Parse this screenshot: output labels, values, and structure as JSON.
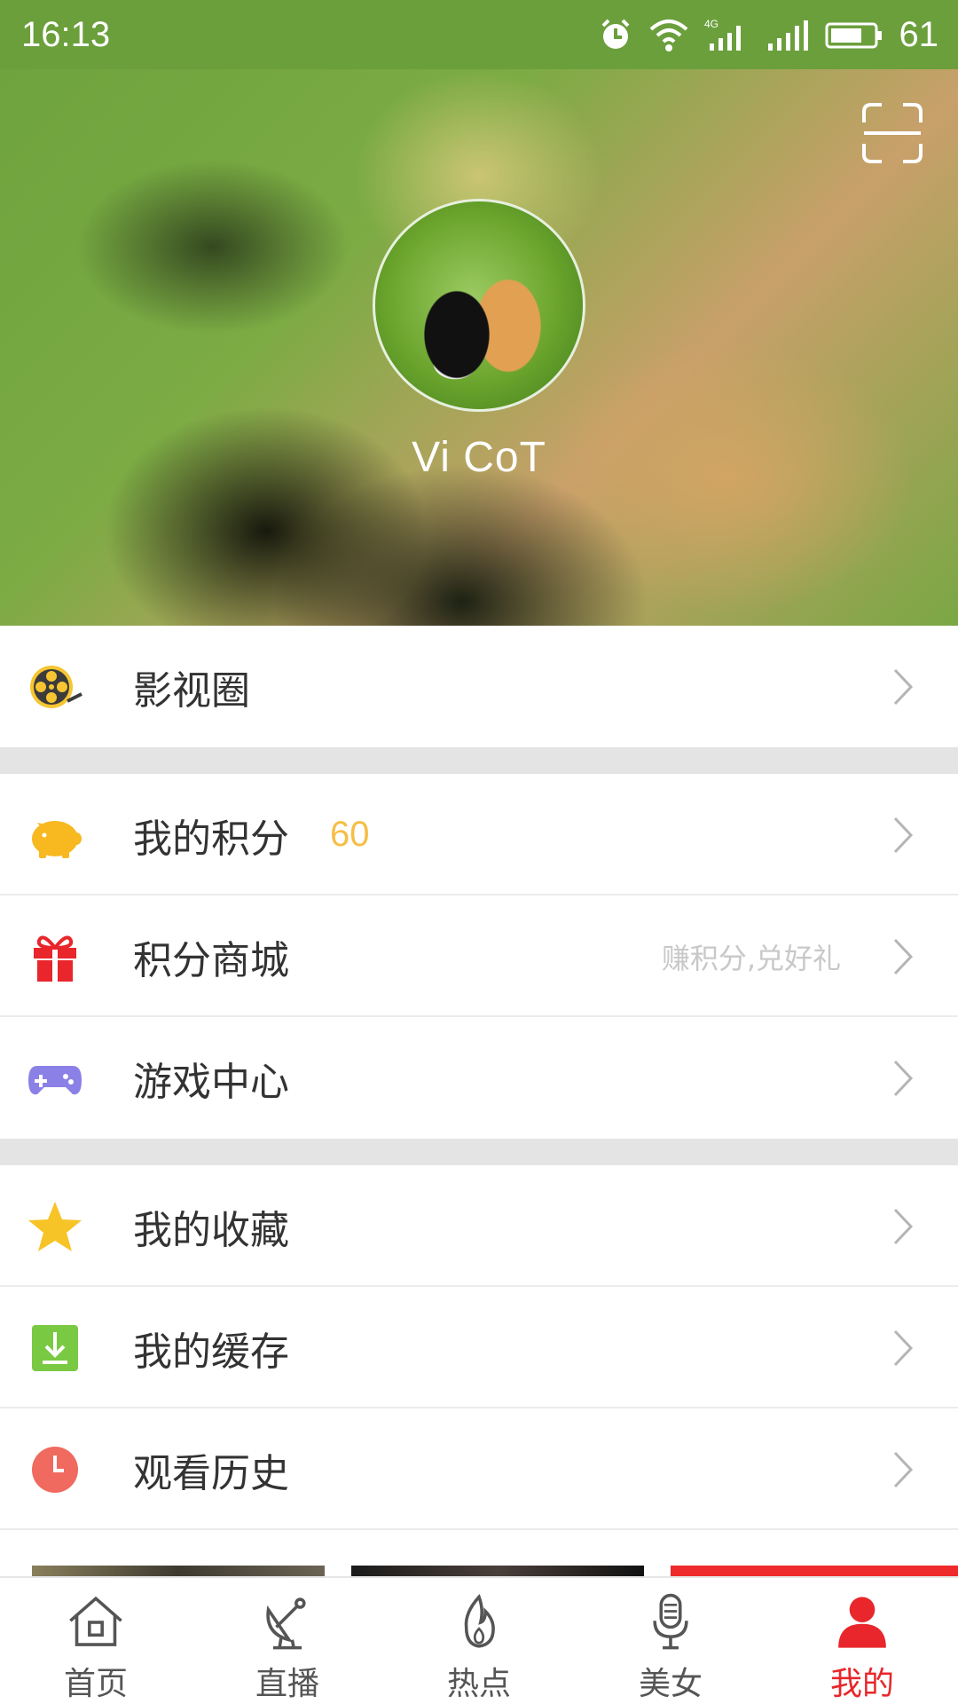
{
  "status_bar": {
    "time": "16:13",
    "network": "4G",
    "battery": "61",
    "icons": [
      "alarm-icon",
      "wifi-icon",
      "signal-4g-icon",
      "signal-icon",
      "battery-icon"
    ]
  },
  "header": {
    "username": "Vi CoT",
    "scan_icon": "scan-icon",
    "avatar": "cats-avatar"
  },
  "menu": {
    "film_circle": {
      "label": "影视圈",
      "icon": "film-reel-icon"
    },
    "points": {
      "label": "我的积分",
      "value": "60",
      "icon": "piggy-bank-icon"
    },
    "points_mall": {
      "label": "积分商城",
      "hint": "赚积分,兑好礼",
      "icon": "gift-icon"
    },
    "game_center": {
      "label": "游戏中心",
      "icon": "gamepad-icon"
    },
    "favorites": {
      "label": "我的收藏",
      "icon": "star-icon"
    },
    "cache": {
      "label": "我的缓存",
      "icon": "download-icon"
    },
    "history": {
      "label": "观看历史",
      "icon": "clock-icon"
    }
  },
  "bottom_nav": {
    "items": [
      {
        "label": "首页",
        "icon": "home-icon"
      },
      {
        "label": "直播",
        "icon": "satellite-dish-icon"
      },
      {
        "label": "热点",
        "icon": "flame-icon"
      },
      {
        "label": "美女",
        "icon": "microphone-icon"
      },
      {
        "label": "我的",
        "icon": "person-icon",
        "active": true
      }
    ]
  },
  "colors": {
    "status_bar": "#6b9f3c",
    "accent_red": "#e8262b",
    "points_yellow": "#f6be45",
    "divider_gray": "#e4e4e4"
  }
}
